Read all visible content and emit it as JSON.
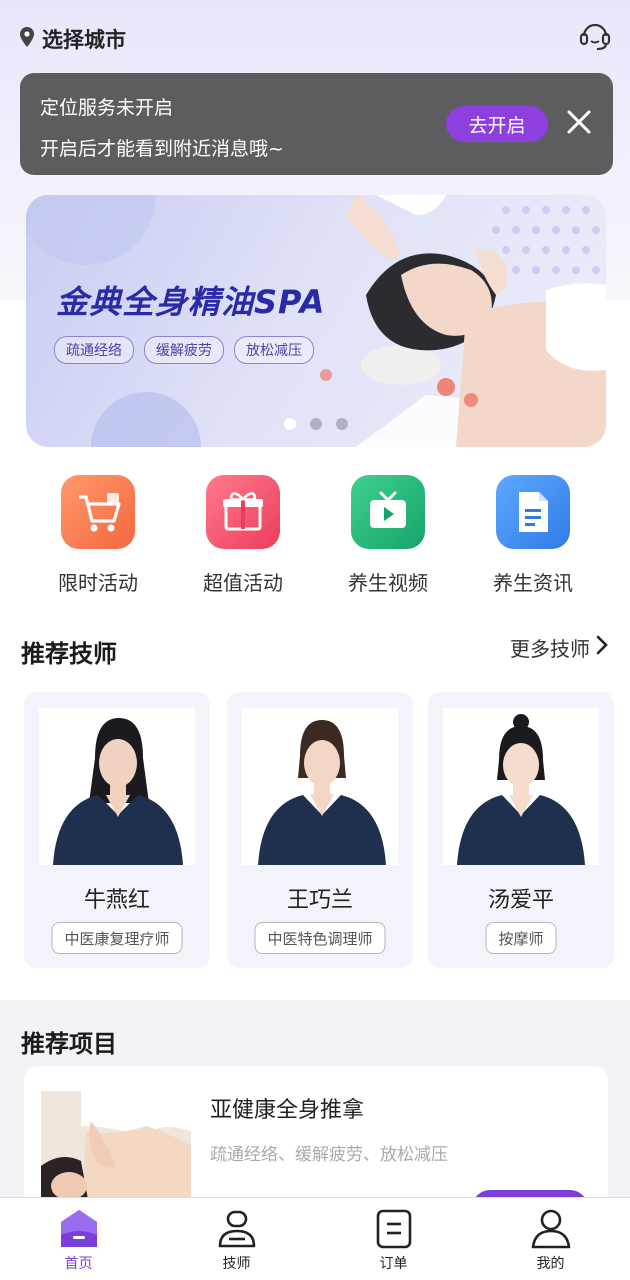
{
  "header": {
    "city_label": "选择城市",
    "location_icon": "location-pin-icon",
    "support_icon": "headset-icon"
  },
  "location_banner": {
    "line1": "定位服务未开启",
    "line2": "开启后才能看到附近消息哦~",
    "enable_button": "去开启",
    "close_icon": "close-icon"
  },
  "hero": {
    "title": "金典全身精油SPA",
    "tags": [
      "疏通经络",
      "缓解疲劳",
      "放松减压"
    ],
    "slide_count": 3,
    "active_slide": 1
  },
  "quick_actions": [
    {
      "label": "限时活动",
      "icon": "cart-icon",
      "color": "#f77c52"
    },
    {
      "label": "超值活动",
      "icon": "gift-icon",
      "color": "#f2506a"
    },
    {
      "label": "养生视频",
      "icon": "tv-play-icon",
      "color": "#22b47a"
    },
    {
      "label": "养生资讯",
      "icon": "document-icon",
      "color": "#3d8cf0"
    }
  ],
  "technicians_section": {
    "title": "推荐技师",
    "more_label": "更多技师",
    "items": [
      {
        "name": "牛燕红",
        "role": "中医康复理疗师"
      },
      {
        "name": "王巧兰",
        "role": "中医特色调理师"
      },
      {
        "name": "汤爱平",
        "role": "按摩师"
      }
    ]
  },
  "projects_section": {
    "title": "推荐项目",
    "items": [
      {
        "name": "亚健康全身推拿",
        "desc": "疏通经络、缓解疲劳、放松减压"
      }
    ]
  },
  "tabbar": [
    {
      "label": "首页",
      "icon": "home-icon",
      "active": true
    },
    {
      "label": "技师",
      "icon": "technician-icon",
      "active": false
    },
    {
      "label": "订单",
      "icon": "order-icon",
      "active": false
    },
    {
      "label": "我的",
      "icon": "user-icon",
      "active": false
    }
  ],
  "colors": {
    "accent": "#7a3fd8",
    "enable_button": "#8e3fe0",
    "banner_bg": "#5d5d5f",
    "hero_title": "#2a2aa8"
  }
}
